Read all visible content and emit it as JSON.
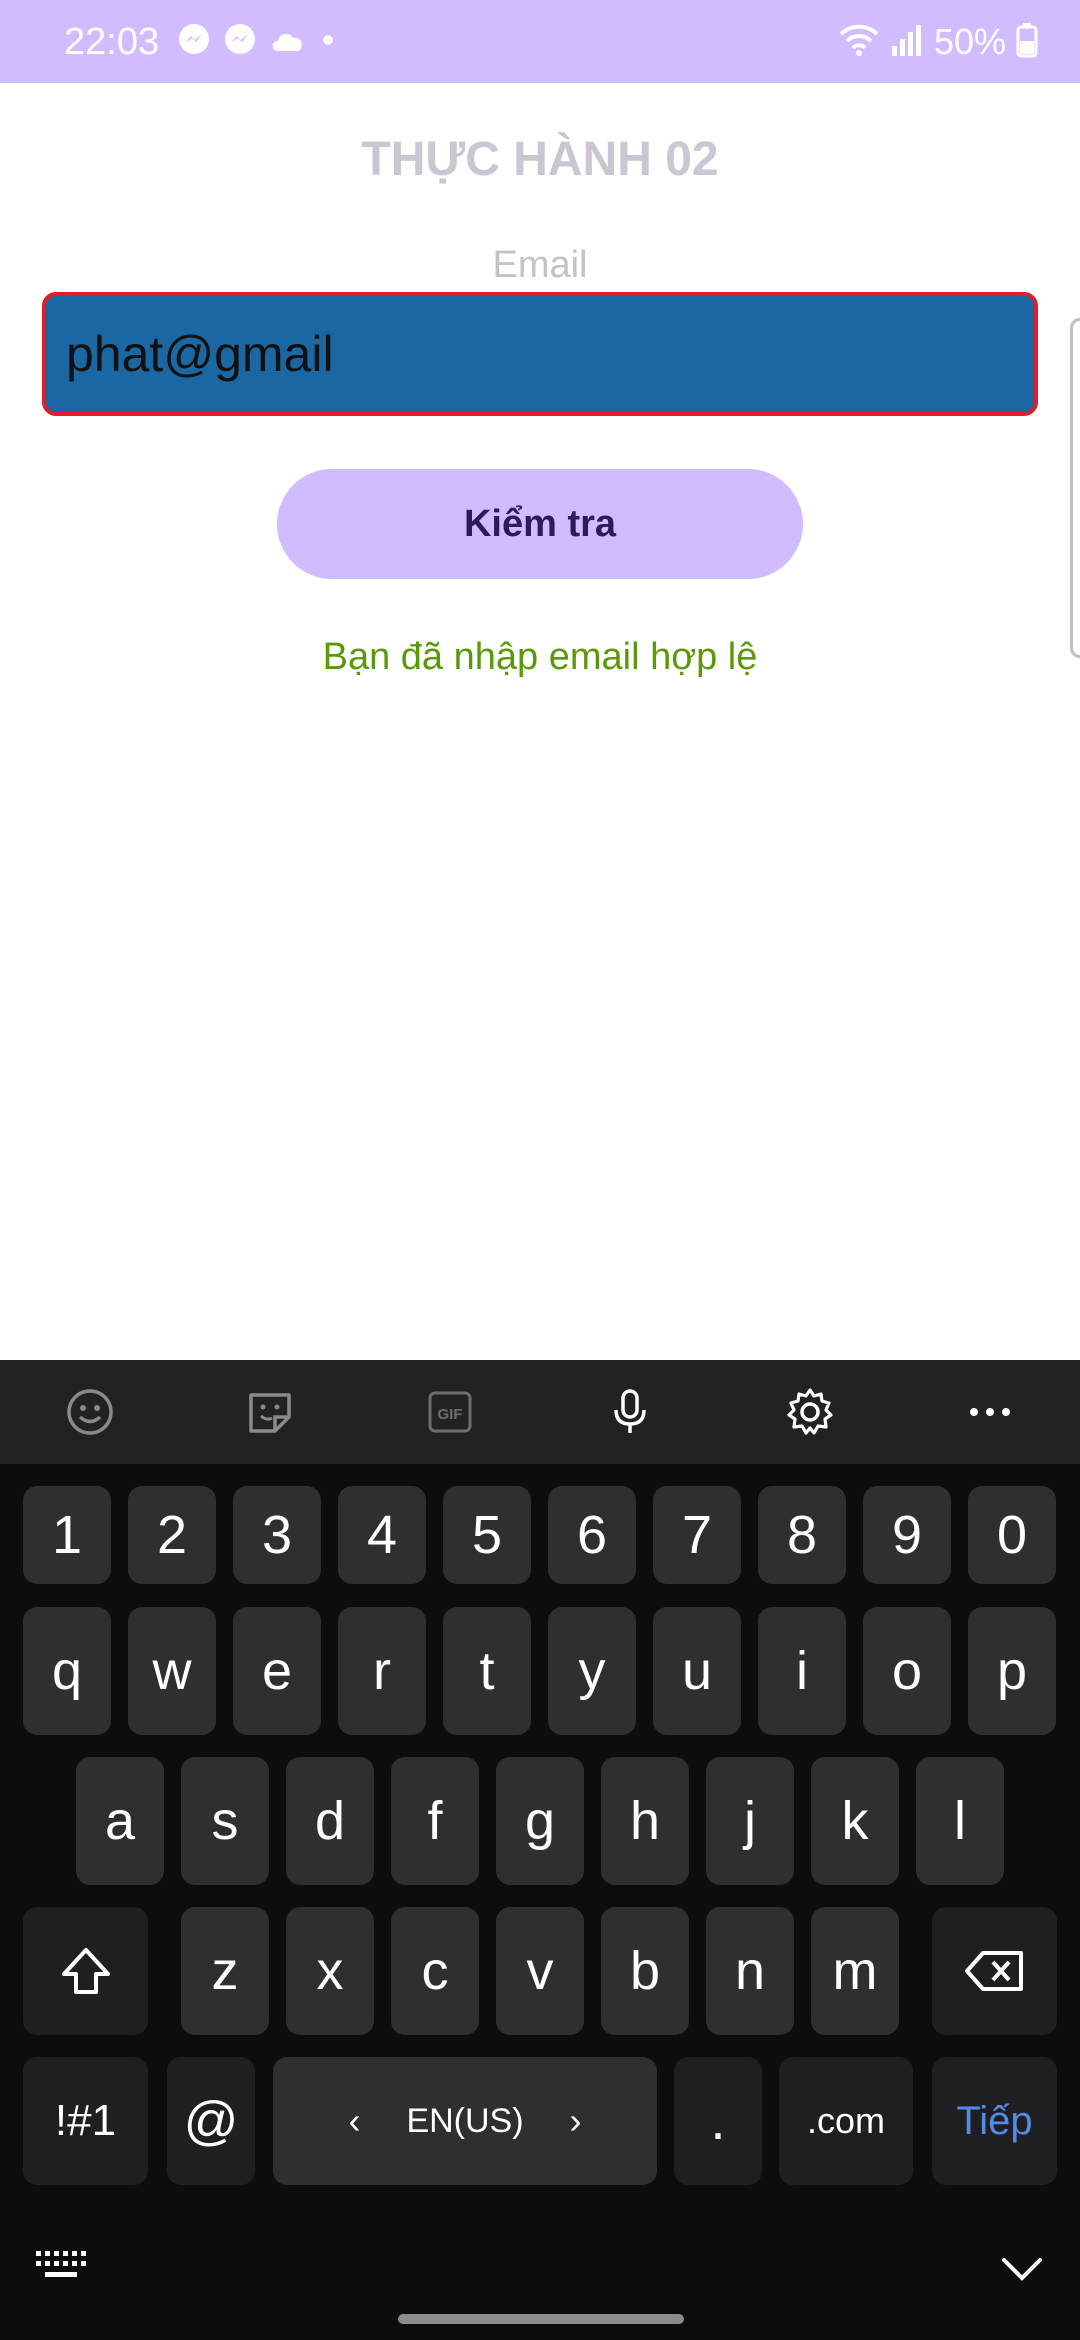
{
  "status_bar": {
    "time": "22:03",
    "battery": "50%",
    "left_icons": [
      "messenger-icon",
      "messenger-icon",
      "cloud-icon",
      "dot-icon"
    ],
    "right_icons": [
      "wifi-icon",
      "signal-icon",
      "battery-icon"
    ]
  },
  "app": {
    "title": "THỰC HÀNH 02",
    "email_label": "Email",
    "email_value": "phat@gmail",
    "check_button": "Kiểm tra",
    "result_message": "Bạn đã nhập email hợp lệ",
    "colors": {
      "status_bar": "#d0bcff",
      "button": "#d0bcff",
      "field_background": "#1b67a4",
      "field_border": "#e01e2a",
      "result_text": "#5a9a0a"
    }
  },
  "keyboard": {
    "toolbar": [
      "emoji-icon",
      "sticker-icon",
      "gif-icon",
      "microphone-icon",
      "settings-icon",
      "more-icon"
    ],
    "gif_label": "GIF",
    "row_numbers": [
      "1",
      "2",
      "3",
      "4",
      "5",
      "6",
      "7",
      "8",
      "9",
      "0"
    ],
    "row1": [
      "q",
      "w",
      "e",
      "r",
      "t",
      "y",
      "u",
      "i",
      "o",
      "p"
    ],
    "row2": [
      "a",
      "s",
      "d",
      "f",
      "g",
      "h",
      "j",
      "k",
      "l"
    ],
    "row3": [
      "z",
      "x",
      "c",
      "v",
      "b",
      "n",
      "m"
    ],
    "symbols_key": "!#1",
    "at_key": "@",
    "language": "EN(US)",
    "period_key": ".",
    "dotcom_key": ".com",
    "enter_key": "Tiếp",
    "bottom_icons": [
      "keyboard-switch-icon",
      "hide-keyboard-icon"
    ]
  }
}
